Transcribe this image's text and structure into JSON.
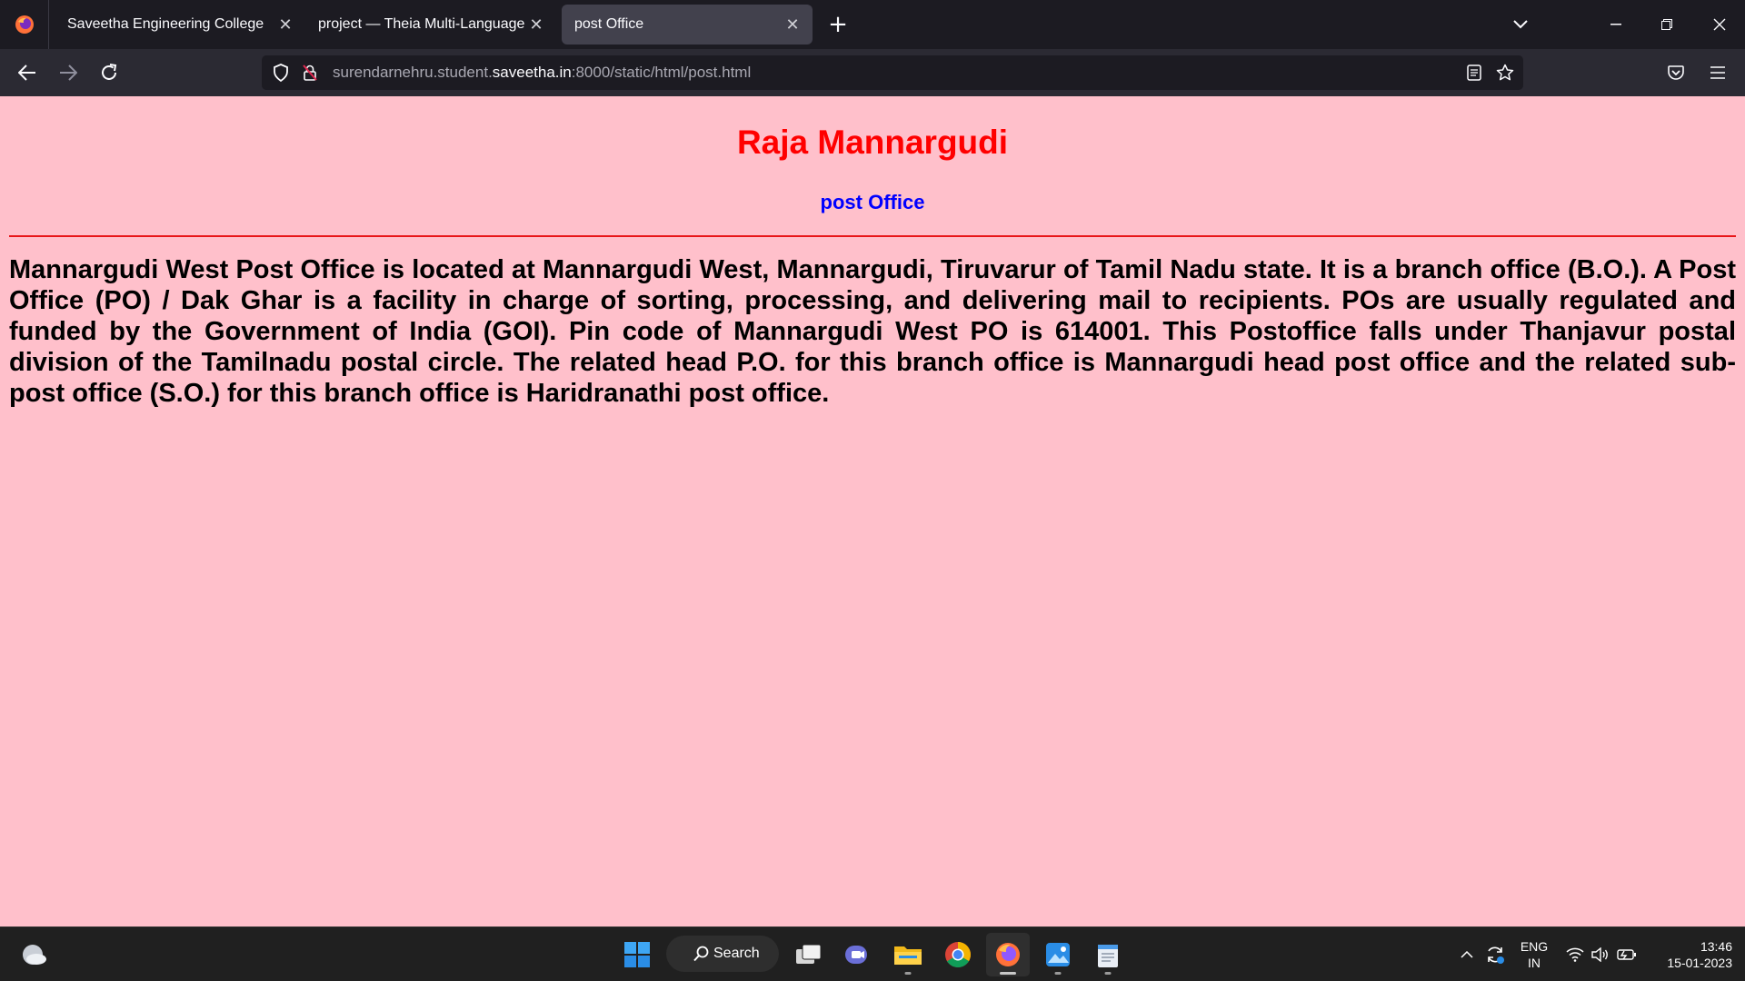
{
  "browser": {
    "tabs": [
      {
        "label": "Saveetha Engineering College",
        "active": false
      },
      {
        "label": "project — Theia Multi-Language Ex",
        "active": false
      },
      {
        "label": "post Office",
        "active": true
      }
    ],
    "url": {
      "prefix": "surendarnehru.student.",
      "domain": "saveetha.in",
      "suffix": ":8000/static/html/post.html"
    }
  },
  "page": {
    "title": "Raja Mannargudi",
    "subtitle": "post Office",
    "body": "Mannargudi West Post Office is located at Mannargudi West, Mannargudi, Tiruvarur of Tamil Nadu state. It is a branch office (B.O.). A Post Office (PO) / Dak Ghar is a facility in charge of sorting, processing, and delivering mail to recipients. POs are usually regulated and funded by the Government of India (GOI). Pin code of Mannargudi West PO is 614001. This Postoffice falls under Thanjavur postal division of the Tamilnadu postal circle. The related head P.O. for this branch office is Mannargudi head post office and the related sub-post office (S.O.) for this branch office is Haridranathi post office.",
    "colors": {
      "background": "#ffc0cb",
      "title": "#ff0000",
      "subtitle": "#0000ff",
      "divider": "#e8161a"
    }
  },
  "taskbar": {
    "search_label": "Search",
    "language_top": "ENG",
    "language_bottom": "IN",
    "time": "13:46",
    "date": "15-01-2023",
    "apps": [
      "start-icon",
      "task-view-icon",
      "teams-chat-icon",
      "file-explorer-icon",
      "chrome-icon",
      "firefox-icon",
      "photos-icon",
      "notepad-icon"
    ]
  }
}
